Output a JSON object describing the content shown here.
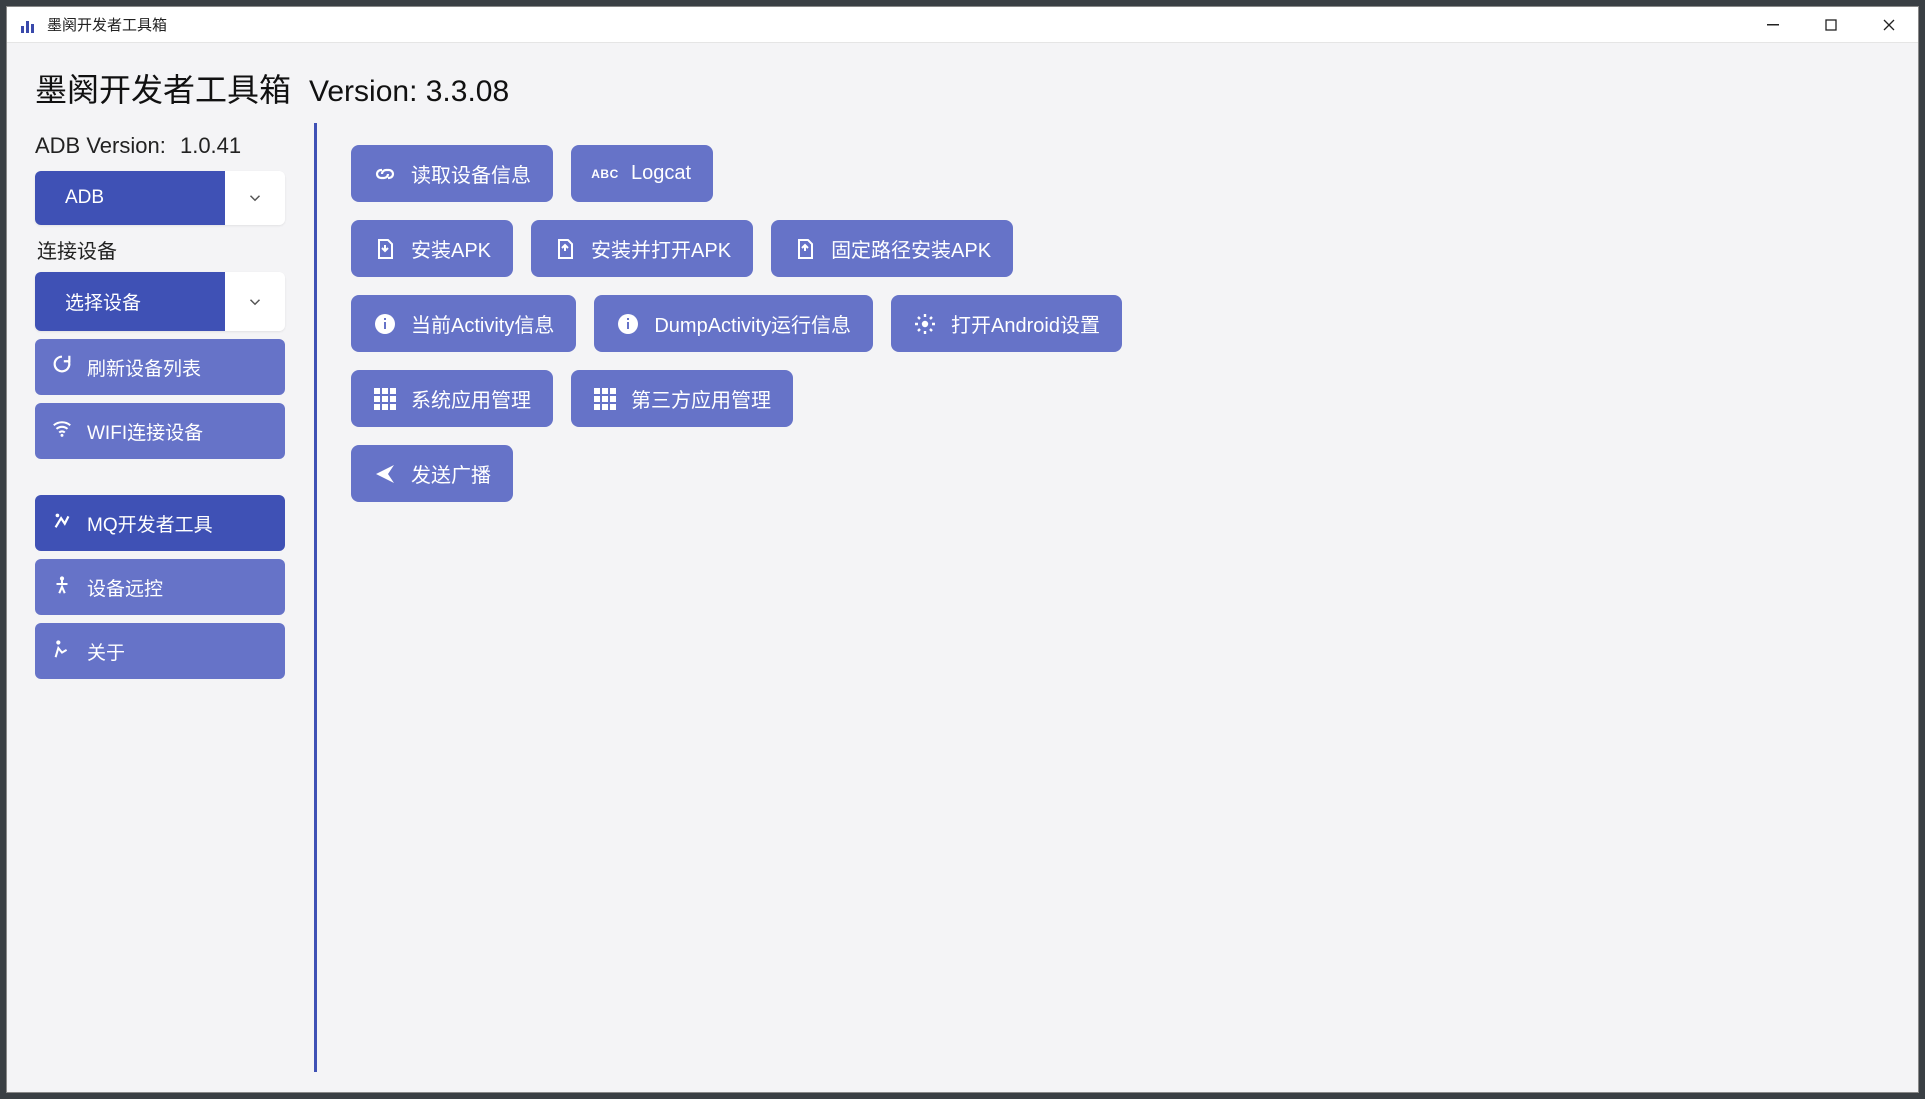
{
  "window": {
    "title": "墨阕开发者工具箱"
  },
  "header": {
    "app_title": "墨阕开发者工具箱",
    "version": "Version: 3.3.08"
  },
  "sidebar": {
    "adb_version_label": "ADB Version:",
    "adb_version_value": "1.0.41",
    "adb_selector": "ADB",
    "device_section_label": "连接设备",
    "device_selector": "选择设备",
    "refresh_devices": "刷新设备列表",
    "wifi_connect": "WIFI连接设备",
    "mq_tools": "MQ开发者工具",
    "remote_control": "设备远控",
    "about": "关于"
  },
  "actions": {
    "row1": {
      "read_device_info": "读取设备信息",
      "logcat": "Logcat"
    },
    "row2": {
      "install_apk": "安装APK",
      "install_open_apk": "安装并打开APK",
      "install_fixed_path_apk": "固定路径安装APK"
    },
    "row3": {
      "current_activity": "当前Activity信息",
      "dump_activity": "DumpActivity运行信息",
      "open_android_settings": "打开Android设置"
    },
    "row4": {
      "system_apps": "系统应用管理",
      "thirdparty_apps": "第三方应用管理"
    },
    "row5": {
      "send_broadcast": "发送广播"
    }
  }
}
